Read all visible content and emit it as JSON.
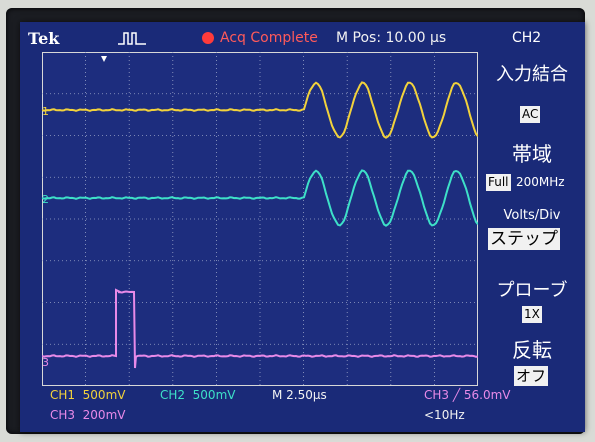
{
  "header": {
    "brand": "Tek",
    "acquisition_status": "Acq Complete",
    "m_position": "M Pos: 10.00 µs",
    "selected_channel": "CH2"
  },
  "menu": {
    "coupling": {
      "title": "入力結合",
      "value": "AC"
    },
    "bandwidth": {
      "title": "帯域",
      "value_box": "Full",
      "value_text": "200MHz"
    },
    "volts_div": {
      "title": "Volts/Div",
      "value": "ステップ"
    },
    "probe": {
      "title": "プローブ",
      "value": "1X"
    },
    "invert": {
      "title": "反転",
      "value": "オフ"
    }
  },
  "status_bar": {
    "ch1": "CH1  500mV",
    "ch2": "CH2  500mV",
    "timebase": "M 2.50µs",
    "trigger": "CH3 ╱ 56.0mV",
    "ch3": "CH3  200mV",
    "trigger_freq": "<10Hz"
  },
  "channel_markers": {
    "ch1": "1",
    "ch2": "2",
    "ch3": "3"
  },
  "colors": {
    "screen": "#1a2a78",
    "ch1": "#f2d23c",
    "ch2": "#3ee0c8",
    "ch3": "#e88ae8",
    "acq": "#ff5a5a"
  }
}
